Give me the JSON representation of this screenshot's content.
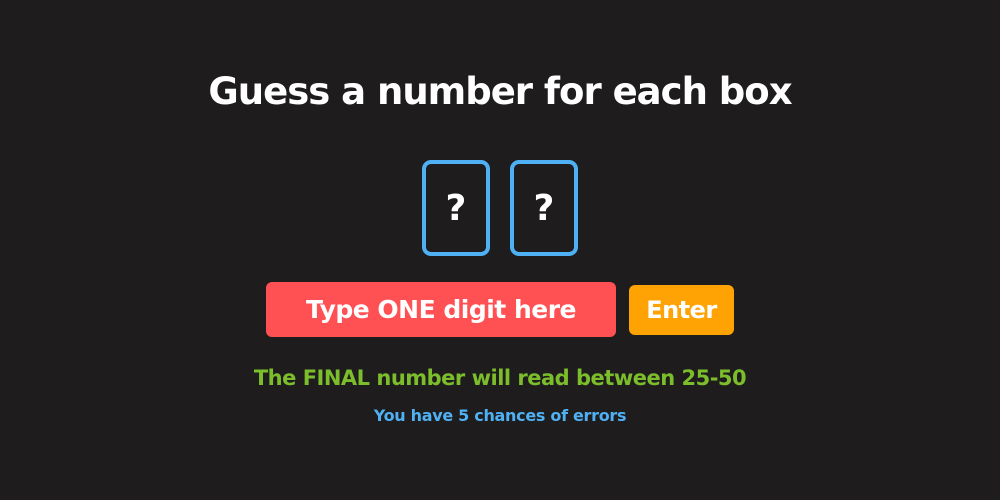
{
  "game": {
    "title": "Guess a number for each box",
    "boxes": [
      {
        "value": "?"
      },
      {
        "value": "?"
      }
    ],
    "input_placeholder": "Type ONE digit here",
    "enter_label": "Enter",
    "range_hint": "The FINAL number will read between 25-50",
    "chances_hint": "You have 5 chances of errors"
  },
  "colors": {
    "background": "#1e1c1d",
    "box_border": "#4fb0f3",
    "input_bg": "#ff5153",
    "enter_bg": "#ffa305",
    "range_hint": "#7cbd2b",
    "chances_hint": "#4fb0f3"
  }
}
